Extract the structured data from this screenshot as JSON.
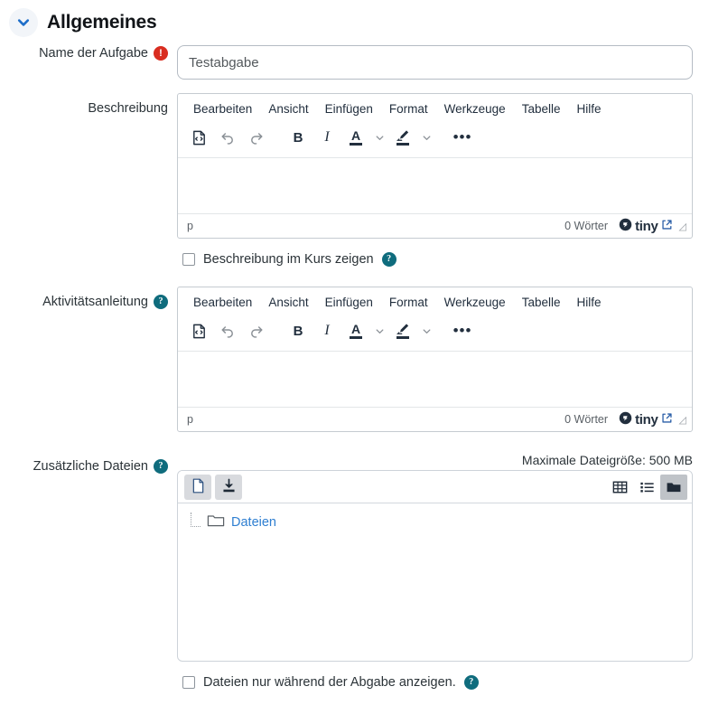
{
  "section": {
    "title": "Allgemeines",
    "collapse_icon": "chevron-down-icon"
  },
  "fields": {
    "name": {
      "label": "Name der Aufgabe",
      "required_icon": "required-exclamation-icon",
      "value": "Testabgabe",
      "placeholder": ""
    },
    "description": {
      "label": "Beschreibung"
    },
    "activity_instructions": {
      "label": "Aktivitätsanleitung",
      "help_icon": "help-circle-icon"
    },
    "additional_files": {
      "label": "Zusätzliche Dateien",
      "help_icon": "help-circle-icon",
      "max_size_text": "Maximale Dateigröße: 500 MB"
    }
  },
  "editor": {
    "menubar": [
      "Bearbeiten",
      "Ansicht",
      "Einfügen",
      "Format",
      "Werkzeuge",
      "Tabelle",
      "Hilfe"
    ],
    "toolbar_icons": [
      "source-code-icon",
      "undo-icon",
      "redo-icon",
      "bold-icon",
      "italic-icon",
      "text-color-icon",
      "text-color-chevron-icon",
      "highlight-color-icon",
      "highlight-color-chevron-icon",
      "more-options-icon"
    ],
    "toolbar_labels": {
      "bold": "B",
      "italic": "I",
      "text_color": "A",
      "more": "•••"
    },
    "status": {
      "path": "p",
      "word_count": "0 Wörter",
      "brand": "tiny",
      "brand_link_icon": "external-link-icon",
      "resize_icon": "resize-grip-icon"
    },
    "content": ""
  },
  "checkboxes": {
    "show_description_on_course_page": {
      "label": "Beschreibung im Kurs zeigen",
      "checked": false,
      "help_icon": "help-circle-icon"
    },
    "show_files_only_during_submission": {
      "label": "Dateien nur während der Abgabe anzeigen.",
      "checked": false,
      "help_icon": "help-circle-icon"
    }
  },
  "filemanager": {
    "buttons": [
      {
        "name": "add-file-button",
        "icon": "file-add-icon"
      },
      {
        "name": "download-all-button",
        "icon": "download-icon"
      }
    ],
    "views": [
      {
        "name": "view-icons-button",
        "icon": "grid-view-icon",
        "active": false
      },
      {
        "name": "view-list-button",
        "icon": "list-view-icon",
        "active": false
      },
      {
        "name": "view-tree-button",
        "icon": "folder-tree-view-icon",
        "active": true
      }
    ],
    "root_folder": {
      "label": "Dateien",
      "icon": "folder-icon"
    }
  },
  "colors": {
    "accent_blue": "#2f7fd1",
    "help_teal": "#0f6c7d",
    "required_red": "#d92d20",
    "link_blue": "#2f7fd1"
  }
}
